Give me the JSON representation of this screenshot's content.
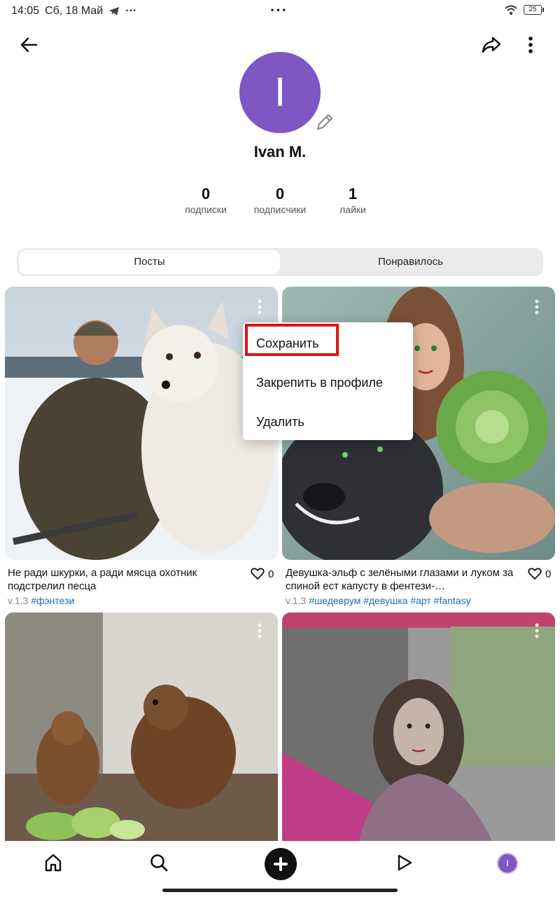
{
  "status_bar": {
    "time": "14:05",
    "date": "Сб, 18 Май",
    "battery": "25"
  },
  "profile": {
    "avatar_letter": "I",
    "name": "Ivan M."
  },
  "stats": [
    {
      "value": "0",
      "label": "подписки"
    },
    {
      "value": "0",
      "label": "подписчики"
    },
    {
      "value": "1",
      "label": "лайки"
    }
  ],
  "tabs": [
    {
      "label": "Посты",
      "active": true
    },
    {
      "label": "Понравилось",
      "active": false
    }
  ],
  "posts": [
    {
      "title": "Не ради шкурки, а ради мясца охотник подстрелил песца",
      "likes": "0",
      "version": "v.1.3",
      "tags": [
        "#фэнтези"
      ]
    },
    {
      "title": "Девушка-эльф с зелёными глазами и луком за спиной ест капусту в фентези-…",
      "likes": "0",
      "version": "v.1.3",
      "tags": [
        "#шедеврум",
        "#девушка",
        "#арт",
        "#fantasy"
      ]
    },
    {},
    {}
  ],
  "context_menu": {
    "items": [
      "Сохранить",
      "Закрепить в профиле",
      "Удалить"
    ]
  },
  "bottom_nav": {
    "avatar_letter": "I"
  },
  "colors": {
    "accent_avatar": "#7e57c2",
    "tag_link": "#1a6db7",
    "highlight": "#e01414"
  }
}
